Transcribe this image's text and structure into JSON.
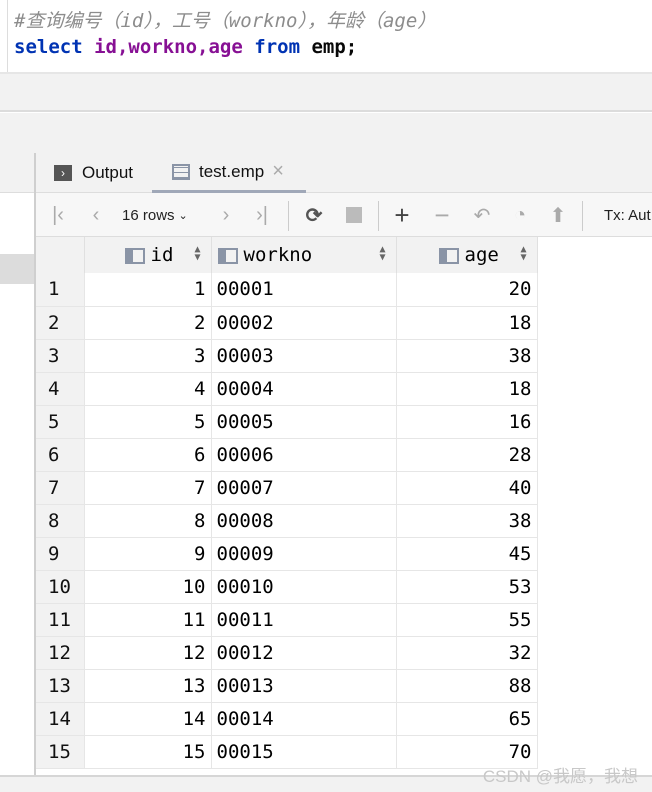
{
  "editor": {
    "comment": "#查询编号（id），工号（workno），年龄（age）",
    "sql": {
      "select": "select",
      "cols": "id,workno,age",
      "sp": " ",
      "from": "from",
      "rest": " emp;"
    }
  },
  "tabs": [
    {
      "label": "Output",
      "icon": "console-icon"
    },
    {
      "label": "test.emp",
      "icon": "table-icon",
      "close": "×"
    }
  ],
  "toolbar": {
    "rows": "16 rows",
    "tx": "Tx: Aut"
  },
  "table": {
    "columns": [
      "id",
      "workno",
      "age"
    ],
    "rows": [
      [
        "1",
        "1",
        "00001",
        "20"
      ],
      [
        "2",
        "2",
        "00002",
        "18"
      ],
      [
        "3",
        "3",
        "00003",
        "38"
      ],
      [
        "4",
        "4",
        "00004",
        "18"
      ],
      [
        "5",
        "5",
        "00005",
        "16"
      ],
      [
        "6",
        "6",
        "00006",
        "28"
      ],
      [
        "7",
        "7",
        "00007",
        "40"
      ],
      [
        "8",
        "8",
        "00008",
        "38"
      ],
      [
        "9",
        "9",
        "00009",
        "45"
      ],
      [
        "10",
        "10",
        "00010",
        "53"
      ],
      [
        "11",
        "11",
        "00011",
        "55"
      ],
      [
        "12",
        "12",
        "00012",
        "32"
      ],
      [
        "13",
        "13",
        "00013",
        "88"
      ],
      [
        "14",
        "14",
        "00014",
        "65"
      ],
      [
        "15",
        "15",
        "00015",
        "70"
      ]
    ]
  },
  "watermark": "CSDN @我愿，我想"
}
